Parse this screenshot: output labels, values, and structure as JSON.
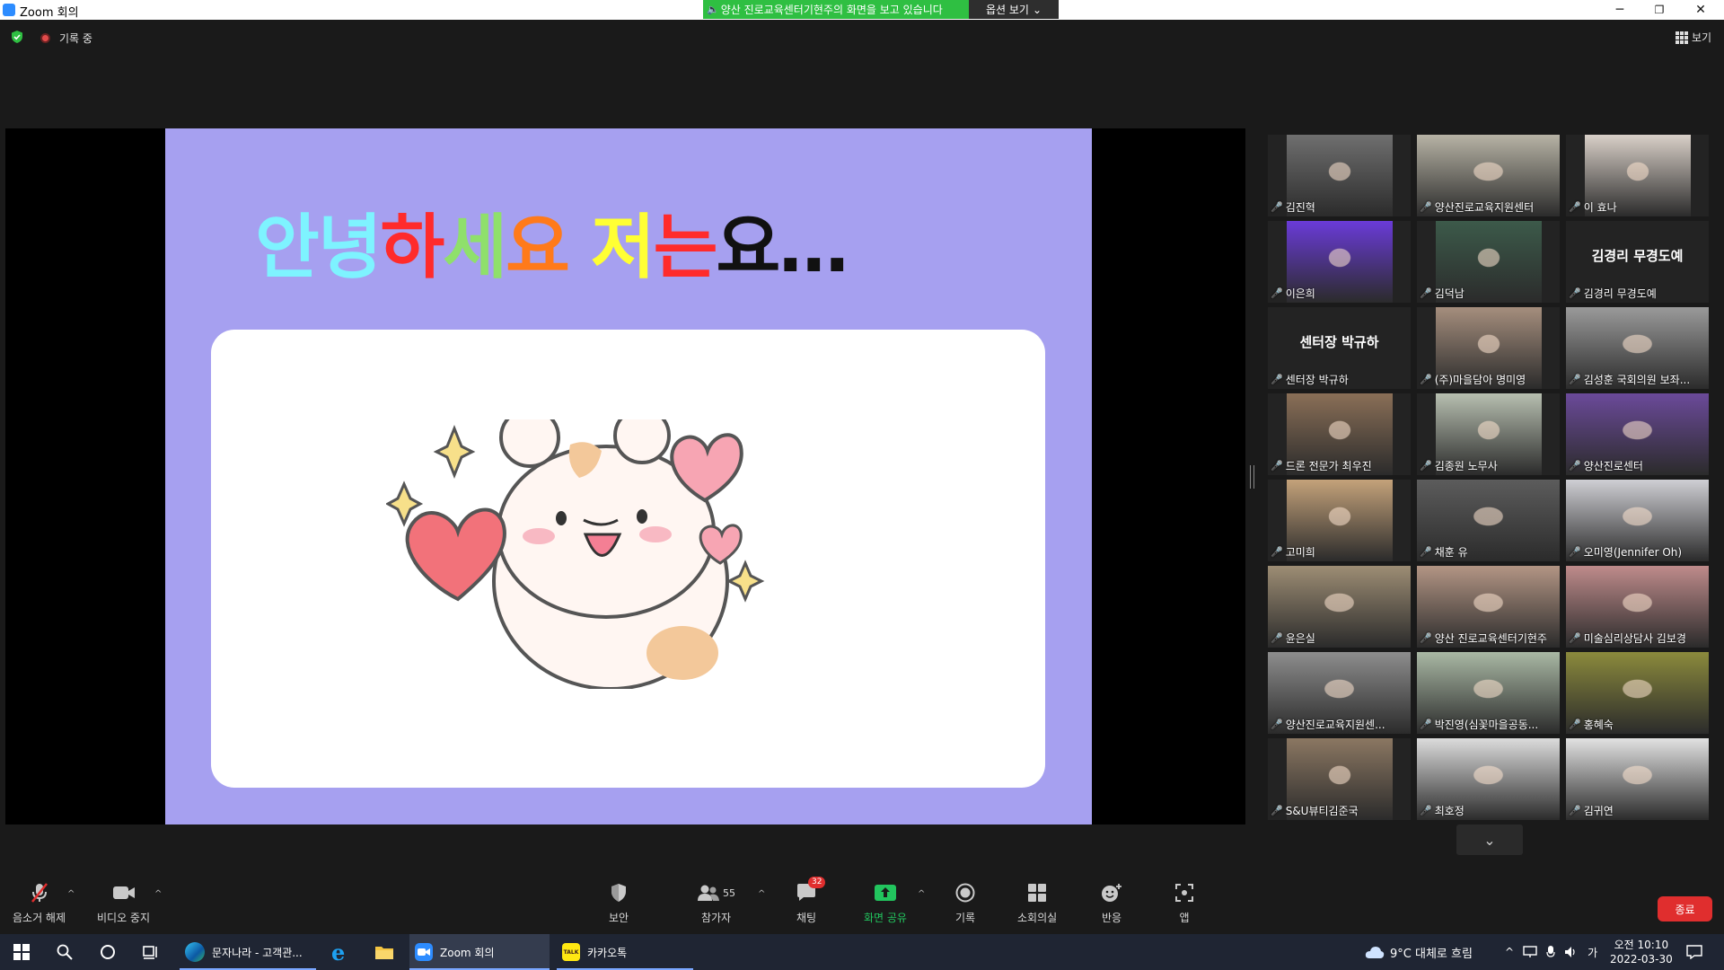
{
  "window": {
    "title": "Zoom 회의",
    "controls": {
      "minimize": "─",
      "restore": "❐",
      "close": "✕"
    }
  },
  "share_banner": {
    "text": "양산 진로교육센터기현주의 화면을 보고 있습니다",
    "options_label": "옵션 보기",
    "options_caret": "⌄"
  },
  "top_bar": {
    "recording_label": "기록 중",
    "view_label": "보기"
  },
  "slide": {
    "title_segments": [
      {
        "text": "안녕",
        "color": "#7ef3ff"
      },
      {
        "text": "하",
        "color": "#ff2b2b"
      },
      {
        "text": "세",
        "color": "#8fe06b"
      },
      {
        "text": "요 ",
        "color": "#ff7a1a"
      },
      {
        "text": "저",
        "color": "#ffff33"
      },
      {
        "text": "는",
        "color": "#ff2b2b"
      },
      {
        "text": "요…",
        "color": "#111111"
      }
    ],
    "colors": {
      "background": "#a6a0f0",
      "card": "#ffffff"
    }
  },
  "participants": [
    {
      "name": "김진혁",
      "image": "person-at-desk",
      "tone": "#6f6f6f"
    },
    {
      "name": "양산진로교육지원센터",
      "image": "person-in-office",
      "tone": "#b7b3a5"
    },
    {
      "name": "이 효나",
      "image": "portrait-woman",
      "tone": "#d9d0c8"
    },
    {
      "name": "이은희",
      "image": "blurred-purple",
      "tone": "#6a3bd8"
    },
    {
      "name": "김덕남",
      "image": "person-standing",
      "tone": "#3c5a4a"
    },
    {
      "name": "김경리 무경도예",
      "image": "",
      "tone": "",
      "center_name": "김경리 무경도예"
    },
    {
      "name": "센터장 박규하",
      "image": "",
      "tone": "",
      "center_name": "센터장 박규하"
    },
    {
      "name": "(주)마을담아 명미영",
      "image": "person-bookshelf",
      "tone": "#a58e7d"
    },
    {
      "name": "김성훈 국회의원 보좌...",
      "image": "man-with-glasses",
      "tone": "#9a9a9a"
    },
    {
      "name": "드론 전문가 최우진",
      "image": "person-wood-wall",
      "tone": "#8a6f57"
    },
    {
      "name": "김종원 노무사",
      "image": "person-office",
      "tone": "#b7bfb0"
    },
    {
      "name": "양산진로센터",
      "image": "person-with-banner",
      "tone": "#6b4a9a"
    },
    {
      "name": "고미희",
      "image": "blurred-room",
      "tone": "#c4a27a"
    },
    {
      "name": "채훈 유",
      "image": "man-with-glasses-dark",
      "tone": "#5c5c5c"
    },
    {
      "name": "오미영(Jennifer Oh)",
      "image": "woman-light-room",
      "tone": "#cfcfd4"
    },
    {
      "name": "윤은실",
      "image": "person-studio",
      "tone": "#9d8d74"
    },
    {
      "name": "양산 진로교육센터기현주",
      "image": "woman-bookshelf",
      "tone": "#b39584",
      "active": true
    },
    {
      "name": "미술심리상담사 김보경",
      "image": "woman-pink-wall",
      "tone": "#bf8b8b"
    },
    {
      "name": "양산진로교육지원센...",
      "image": "woman-mask",
      "tone": "#8d8d8d"
    },
    {
      "name": "박진영(심꽃마을공동...",
      "image": "woman-green-bg",
      "tone": "#a9b8a4"
    },
    {
      "name": "홍혜숙",
      "image": "autumn-trees",
      "tone": "#8b8a3c"
    },
    {
      "name": "S&U뷰티김준국",
      "image": "man-striped-shirt",
      "tone": "#8b7762"
    },
    {
      "name": "최호정",
      "image": "person-white-wall",
      "tone": "#dcdcdc"
    },
    {
      "name": "김귀연",
      "image": "woman-bright-room",
      "tone": "#e2e2e2"
    }
  ],
  "toolbar": {
    "unmute": "음소거 해제",
    "stop_video": "비디오 중지",
    "security": "보안",
    "participants": "참가자",
    "participants_count": "55",
    "chat": "채팅",
    "chat_badge": "32",
    "share_screen": "화면 공유",
    "record": "기록",
    "breakout": "소회의실",
    "reactions": "반응",
    "apps": "앱",
    "end": "종료",
    "share_color": "#22c55e",
    "end_color": "#e02e2e"
  },
  "taskbar": {
    "apps": [
      {
        "label": "문자나라 - 고객관...",
        "icon": "edge-icon"
      },
      {
        "label": "",
        "icon": "ie-icon"
      },
      {
        "label": "",
        "icon": "folder-icon"
      },
      {
        "label": "Zoom 회의",
        "icon": "zoom-icon"
      },
      {
        "label": "카카오톡",
        "icon": "kakaotalk-icon"
      }
    ],
    "kakao_icon_text": "TALK",
    "weather": "9°C  대체로 흐림",
    "time": "오전 10:10",
    "date": "2022-03-30",
    "ime": "가"
  }
}
